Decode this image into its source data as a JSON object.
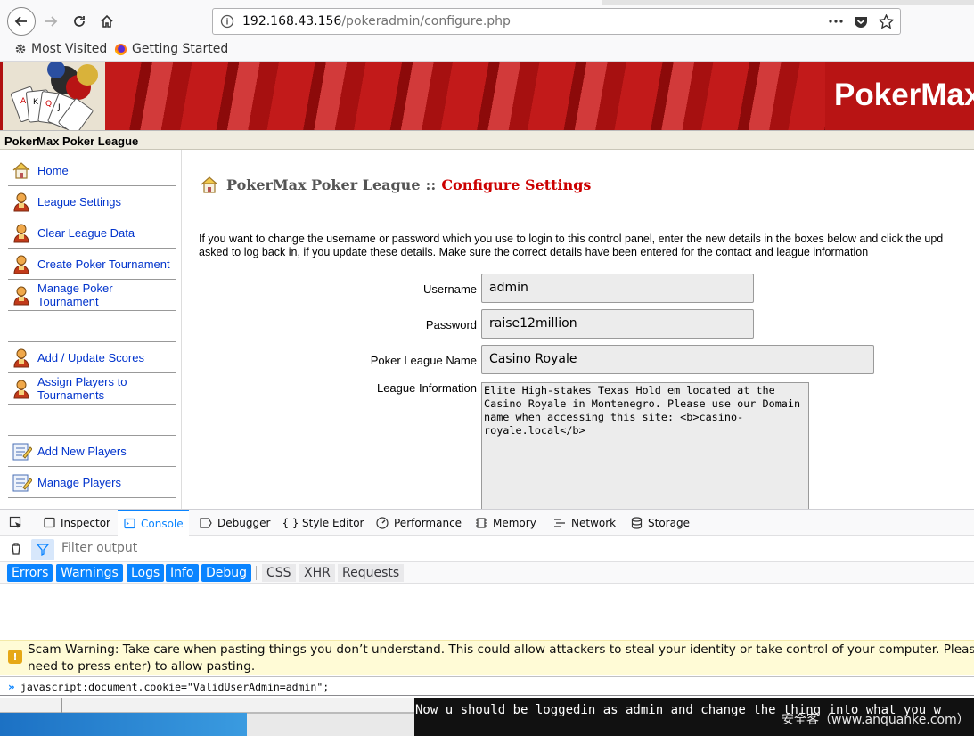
{
  "browser": {
    "url_host": "192.168.43.156",
    "url_path": "/pokeradmin/configure.php",
    "bookmarks": [
      "Most Visited",
      "Getting Started"
    ]
  },
  "site": {
    "banner_title": "PokerMax P",
    "subheader": "PokerMax Poker League"
  },
  "sidebar": {
    "items": [
      {
        "label": "Home"
      },
      {
        "label": "League Settings"
      },
      {
        "label": "Clear League Data"
      },
      {
        "label": "Create Poker Tournament"
      },
      {
        "label": "Manage Poker Tournament"
      },
      {
        "label": "Add / Update Scores"
      },
      {
        "label": "Assign Players to Tournaments"
      },
      {
        "label": "Add New Players"
      },
      {
        "label": "Manage Players"
      }
    ]
  },
  "main": {
    "heading_league": "PokerMax Poker League",
    "heading_sep": "::",
    "heading_title": "Configure Settings",
    "intro_line1": "If you want to change the username or password which you use to login to this control panel, enter the new details in the boxes below and click the upd",
    "intro_line2": "asked to log back in, if you update these details. Make sure the correct details have been entered for the contact and league information",
    "form": {
      "username_label": "Username",
      "username_value": "admin",
      "password_label": "Password",
      "password_value": "raise12million",
      "league_name_label": "Poker League Name",
      "league_name_value": "Casino Royale",
      "league_info_label": "League Information",
      "league_info_value": "Elite High-stakes Texas Hold em located at the\nCasino Royale in Montenegro. Please use our Domain\nname when accessing this site: <b>casino-\nroyale.local</b>"
    }
  },
  "devtools": {
    "tabs": [
      {
        "label": "Inspector",
        "icon": "inspector-icon"
      },
      {
        "label": "Console",
        "icon": "console-icon",
        "selected": true
      },
      {
        "label": "Debugger",
        "icon": "debugger-icon"
      },
      {
        "label": "Style Editor",
        "icon": "style-editor-icon"
      },
      {
        "label": "Performance",
        "icon": "performance-icon"
      },
      {
        "label": "Memory",
        "icon": "memory-icon"
      },
      {
        "label": "Network",
        "icon": "network-icon"
      },
      {
        "label": "Storage",
        "icon": "storage-icon"
      }
    ],
    "filter_placeholder": "Filter output",
    "levels_on": [
      "Errors",
      "Warnings",
      "Logs",
      "Info",
      "Debug"
    ],
    "levels_off": [
      "CSS",
      "XHR",
      "Requests"
    ],
    "scam_line1": "Scam Warning: Take care when pasting things you don’t understand. This could allow attackers to steal your identity or take control of your computer. Please type ‘al",
    "scam_line2": "need to press enter) to allow pasting.",
    "command": "javascript:document.cookie=\"ValidUserAdmin=admin\";"
  },
  "overlay": {
    "caption": "Now u should be loggedin as admin and change the thing into what you w",
    "watermark": "安全客（www.anquanke.com）"
  },
  "colors": {
    "accent_blue": "#0a84ff",
    "banner_red": "#b01010",
    "heading_red": "#cc0000",
    "link_blue": "#0033cc"
  }
}
